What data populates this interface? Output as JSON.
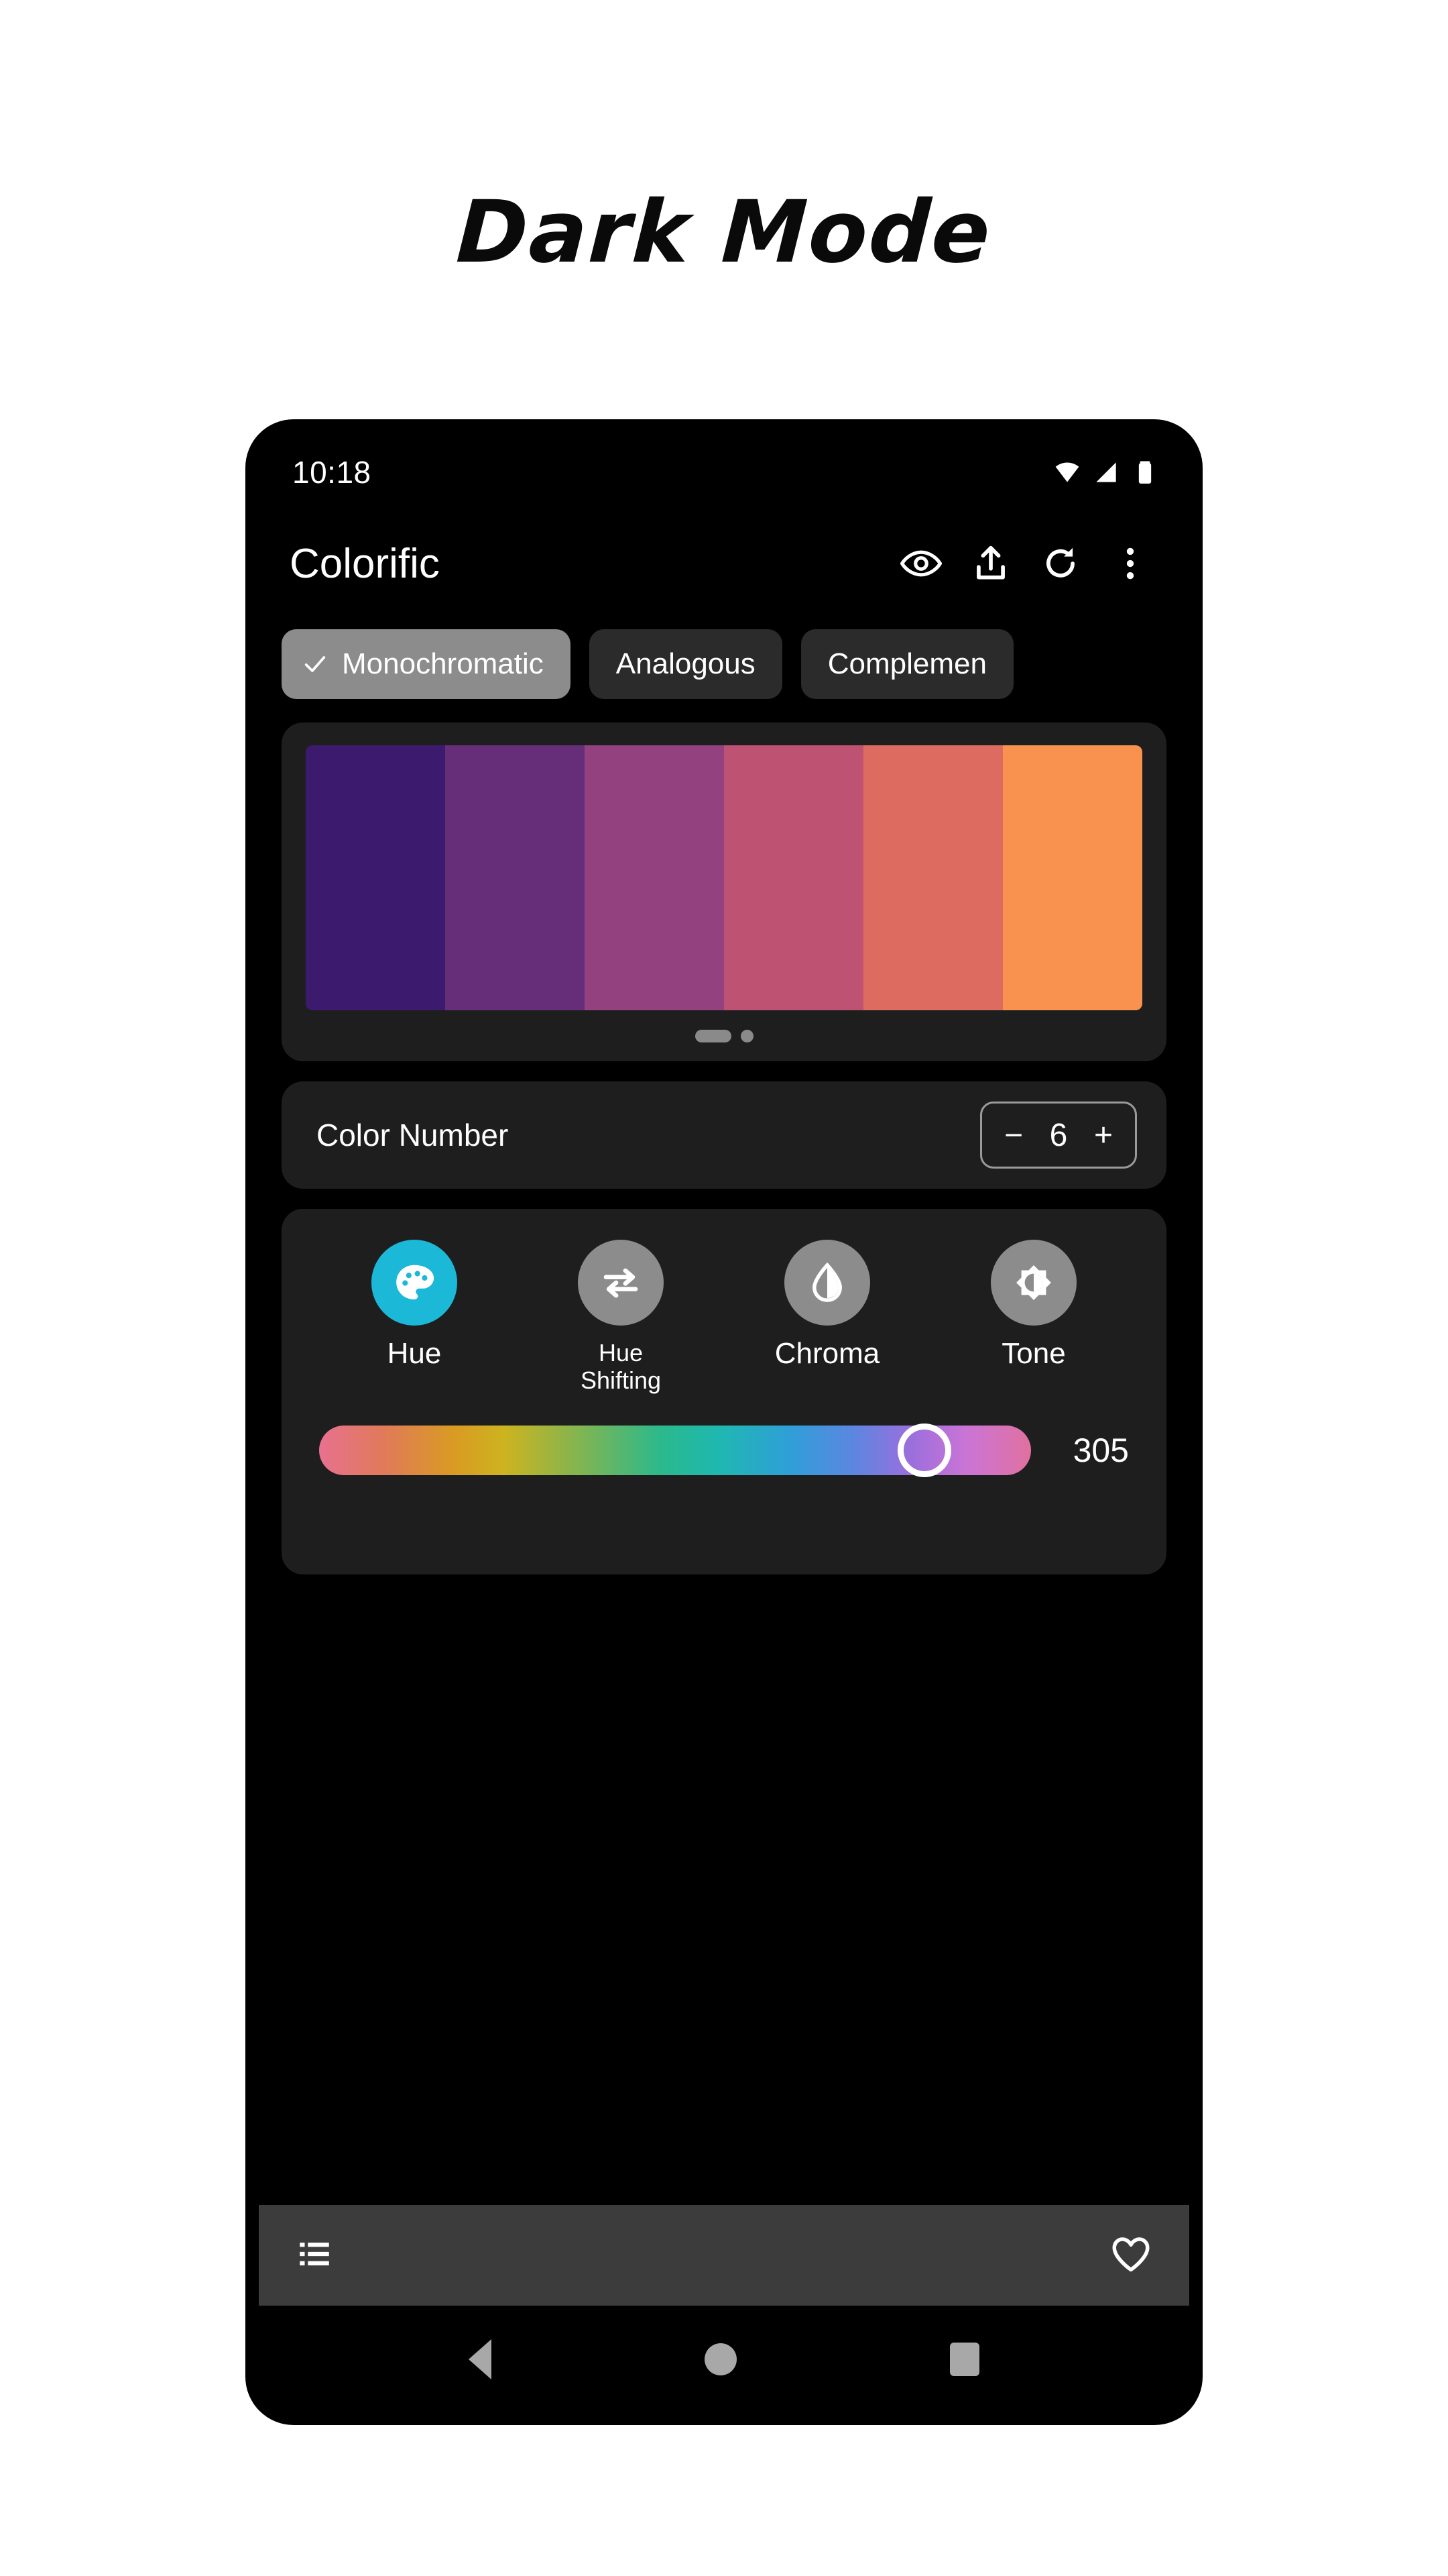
{
  "heading": "Dark Mode",
  "statusbar": {
    "time": "10:18",
    "icons": [
      "wifi-icon",
      "cellular-signal-icon",
      "battery-icon"
    ]
  },
  "appbar": {
    "title": "Colorific",
    "actions": [
      {
        "name": "preview-eye-icon",
        "label": "Preview"
      },
      {
        "name": "export-share-icon",
        "label": "Export"
      },
      {
        "name": "refresh-icon",
        "label": "Refresh"
      },
      {
        "name": "overflow-menu-icon",
        "label": "More options"
      }
    ]
  },
  "chips": [
    {
      "label": "Monochromatic",
      "selected": true
    },
    {
      "label": "Analogous",
      "selected": false
    },
    {
      "label": "Complemen",
      "selected": false
    }
  ],
  "palette": {
    "swatches": [
      "#3C1A6E",
      "#662E78",
      "#944180",
      "#BE5273",
      "#DE6B5F",
      "#F9924E"
    ],
    "page_indicator": {
      "pages": 2,
      "active": 1
    }
  },
  "color_number": {
    "label": "Color Number",
    "decrement": "−",
    "value": "6",
    "increment": "+"
  },
  "tools": [
    {
      "label": "Hue",
      "icon": "palette-icon",
      "active": true,
      "two_line": false
    },
    {
      "label": "Hue\nShifting",
      "line1": "Hue",
      "line2": "Shifting",
      "icon": "swap-arrows-icon",
      "active": false,
      "two_line": true
    },
    {
      "label": "Chroma",
      "icon": "water-drop-half-icon",
      "active": false,
      "two_line": false
    },
    {
      "label": "Tone",
      "icon": "brightness-half-icon",
      "active": false,
      "two_line": false
    }
  ],
  "slider": {
    "name": "hue-slider",
    "value": "305",
    "min": 0,
    "max": 360,
    "thumb_percent": 85
  },
  "bottombar": {
    "left_icon": "list-icon",
    "right_icon": "heart-outline-icon"
  },
  "navbar": {
    "back": "back-triangle-icon",
    "home": "home-circle-icon",
    "recents": "recents-square-icon"
  },
  "colors": {
    "accent": "#1BB8D8",
    "card": "#1E1E1E",
    "chip_selected": "#8C8C8C",
    "chip": "#2B2B2B",
    "bottombar": "#3C3C3C",
    "background": "#000000"
  }
}
